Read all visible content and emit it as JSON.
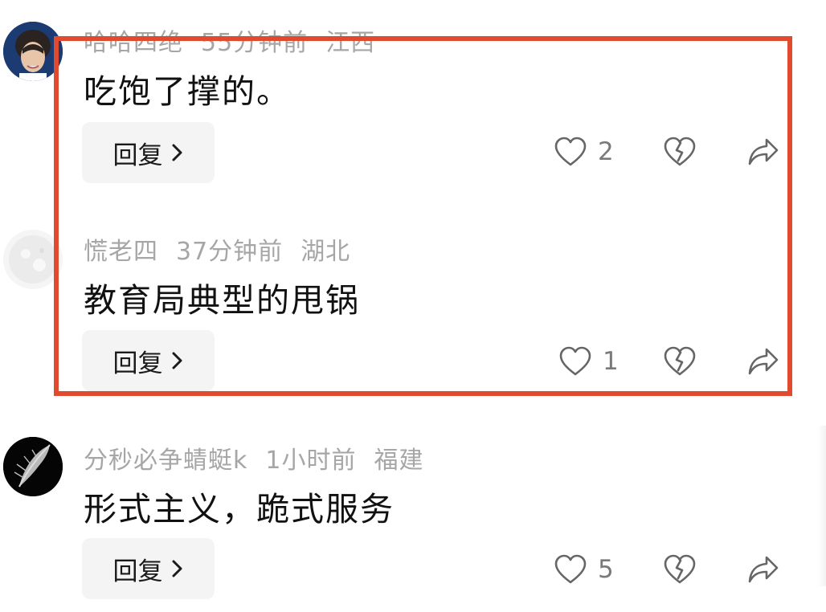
{
  "comments": [
    {
      "author": "哈哈四绝",
      "time": "55分钟前",
      "location": "江西",
      "text": "吃饱了撑的。",
      "reply_label": "回复",
      "likes": "2"
    },
    {
      "author": "慌老四",
      "time": "37分钟前",
      "location": "湖北",
      "text": "教育局典型的甩锅",
      "reply_label": "回复",
      "likes": "1"
    },
    {
      "author": "分秒必争蜻蜓k",
      "time": "1小时前",
      "location": "福建",
      "text": "形式主义，跪式服务",
      "reply_label": "回复",
      "likes": "5"
    }
  ],
  "colors": {
    "highlight_border": "#e04a2f",
    "meta_text": "#a6a6a6",
    "body_text": "#111111",
    "reply_bg": "#f4f4f4"
  },
  "icons": [
    "heart-icon",
    "broken-heart-icon",
    "share-icon",
    "chevron-right-icon"
  ]
}
